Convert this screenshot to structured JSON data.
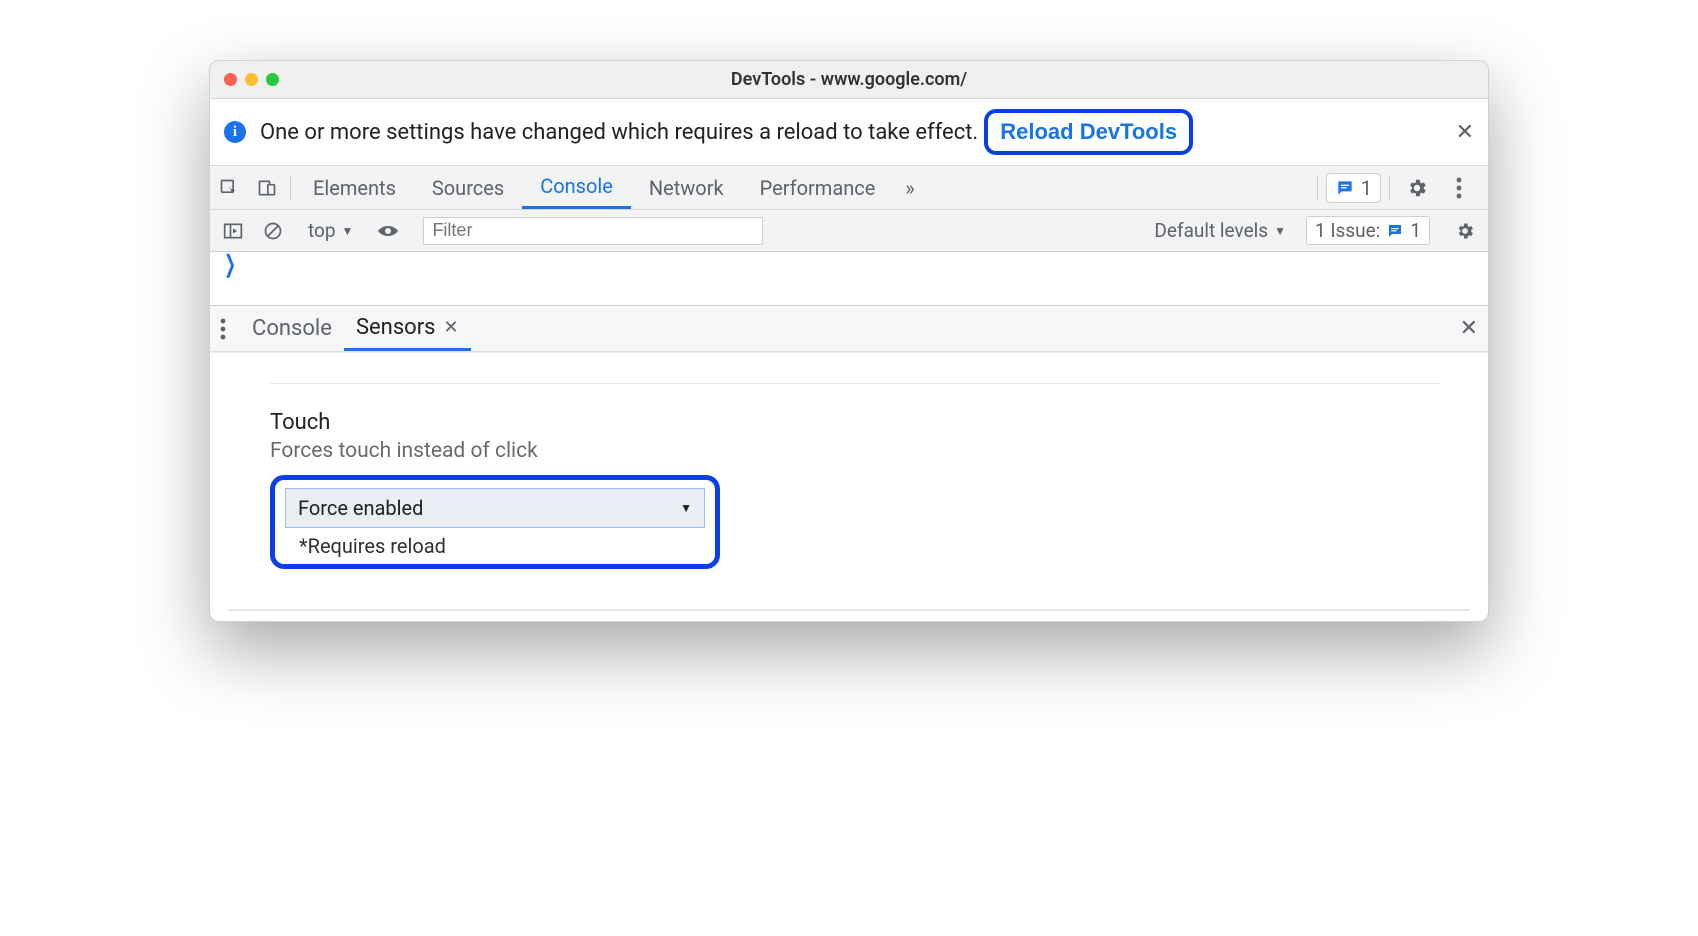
{
  "titlebar": {
    "title": "DevTools - www.google.com/"
  },
  "infobar": {
    "message": "One or more settings have changed which requires a reload to take effect.",
    "reload_label": "Reload DevTools"
  },
  "tabs": {
    "items": [
      "Elements",
      "Sources",
      "Console",
      "Network",
      "Performance"
    ],
    "active_index": 2,
    "more": "»",
    "message_count": "1"
  },
  "console_toolbar": {
    "context": "top",
    "filter_placeholder": "Filter",
    "levels": "Default levels",
    "issues_label": "1 Issue:",
    "issues_count": "1"
  },
  "drawer": {
    "tabs": [
      "Console",
      "Sensors"
    ],
    "active_index": 1
  },
  "sensors": {
    "section_title": "Touch",
    "section_desc": "Forces touch instead of click",
    "select_value": "Force enabled",
    "note": "*Requires reload"
  }
}
